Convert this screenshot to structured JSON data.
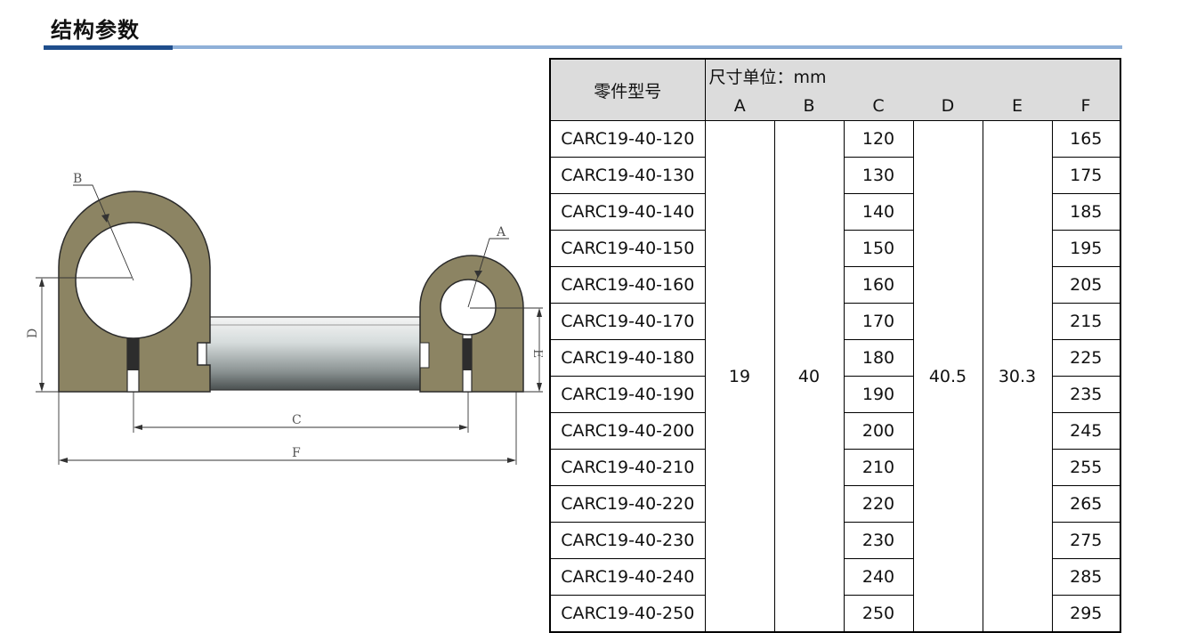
{
  "page_title": "结构参数",
  "table": {
    "part_header": "零件型号",
    "unit_header": "尺寸单位：mm",
    "columns": [
      "A",
      "B",
      "C",
      "D",
      "E",
      "F"
    ],
    "shared": {
      "A": "19",
      "B": "40",
      "D": "40.5",
      "E": "30.3"
    },
    "rows": [
      {
        "part": "CARC19-40-120",
        "C": "120",
        "F": "165"
      },
      {
        "part": "CARC19-40-130",
        "C": "130",
        "F": "175"
      },
      {
        "part": "CARC19-40-140",
        "C": "140",
        "F": "185"
      },
      {
        "part": "CARC19-40-150",
        "C": "150",
        "F": "195"
      },
      {
        "part": "CARC19-40-160",
        "C": "160",
        "F": "205"
      },
      {
        "part": "CARC19-40-170",
        "C": "170",
        "F": "215"
      },
      {
        "part": "CARC19-40-180",
        "C": "180",
        "F": "225"
      },
      {
        "part": "CARC19-40-190",
        "C": "190",
        "F": "235"
      },
      {
        "part": "CARC19-40-200",
        "C": "200",
        "F": "245"
      },
      {
        "part": "CARC19-40-210",
        "C": "210",
        "F": "255"
      },
      {
        "part": "CARC19-40-220",
        "C": "220",
        "F": "265"
      },
      {
        "part": "CARC19-40-230",
        "C": "230",
        "F": "275"
      },
      {
        "part": "CARC19-40-240",
        "C": "240",
        "F": "285"
      },
      {
        "part": "CARC19-40-250",
        "C": "250",
        "F": "295"
      }
    ]
  },
  "drawing_labels": {
    "A": "A",
    "B": "B",
    "C": "C",
    "D": "D",
    "E": "E",
    "F": "F"
  },
  "colors": {
    "clamp_fill": "#8c8463",
    "accent_rule": "#1f4e8c",
    "rule_light": "#8fb0d8"
  }
}
